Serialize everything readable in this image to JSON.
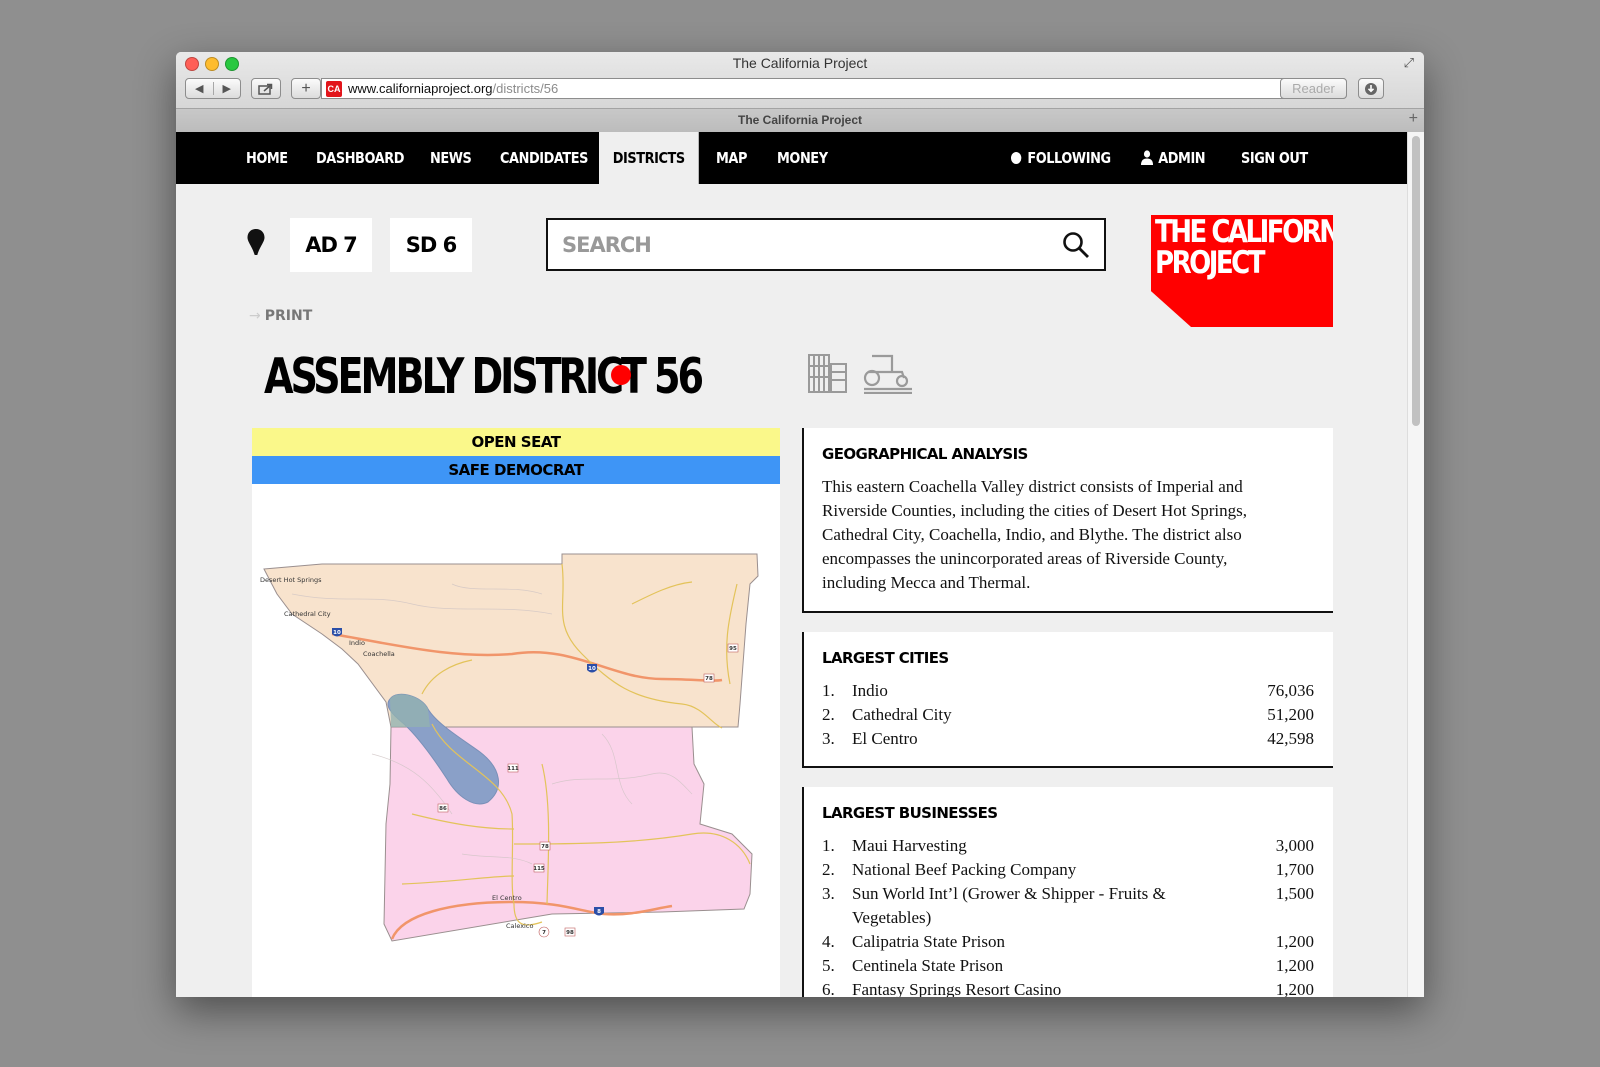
{
  "browser": {
    "window_title": "The California Project",
    "favicon_text": "CA",
    "url_domain": "www.californiaproject.org",
    "url_path": "/districts/56",
    "reader_label": "Reader",
    "tab_title": "The California Project"
  },
  "nav": {
    "items": [
      "HOME",
      "DASHBOARD",
      "NEWS",
      "CANDIDATES",
      "DISTRICTS",
      "MAP",
      "MONEY"
    ],
    "active": "DISTRICTS",
    "following": "FOLLOWING",
    "admin": "ADMIN",
    "sign_out": "SIGN OUT"
  },
  "location": {
    "assembly": "AD 7",
    "senate": "SD 6"
  },
  "search": {
    "placeholder": "SEARCH"
  },
  "logo": {
    "line1": "THE CALIFORNIA",
    "line2": "PROJECT"
  },
  "print_label": "PRINT",
  "district": {
    "title": "ASSEMBLY DISTRICT 56",
    "party_color": "#ff0000",
    "type_icons": [
      "urban-buildings-icon",
      "agriculture-tractor-icon"
    ],
    "seat_status": "OPEN SEAT",
    "lean": "SAFE DEMOCRAT"
  },
  "map": {
    "labels": {
      "desert_hot_springs": "Desert Hot Springs",
      "cathedral_city": "Cathedral City",
      "indio": "Indio",
      "coachella": "Coachella",
      "el_centro": "El Centro",
      "calexico": "Calexico"
    },
    "shields": {
      "i10_west": "10",
      "i10_east": "10",
      "i8": "8",
      "r95": "95",
      "r78": "78",
      "r111": "111",
      "r86": "86",
      "r78b": "78",
      "r115": "115",
      "r7": "7",
      "r98": "98"
    }
  },
  "geographical": {
    "title": "GEOGRAPHICAL ANALYSIS",
    "text": "This eastern Coachella Valley district consists of Imperial and Riverside Counties, including the cities of Desert Hot Springs, Cathedral City, Coachella, Indio, and Blythe. The district also encompasses the unincorporated areas of Riverside County, including Mecca and Thermal."
  },
  "largest_cities": {
    "title": "LARGEST CITIES",
    "rows": [
      {
        "rank": "1.",
        "name": "Indio",
        "value": "76,036"
      },
      {
        "rank": "2.",
        "name": "Cathedral City",
        "value": "51,200"
      },
      {
        "rank": "3.",
        "name": "El Centro",
        "value": "42,598"
      }
    ]
  },
  "largest_businesses": {
    "title": "LARGEST BUSINESSES",
    "rows": [
      {
        "rank": "1.",
        "name": "Maui Harvesting",
        "value": "3,000"
      },
      {
        "rank": "2.",
        "name": "National Beef Packing Company",
        "value": "1,700"
      },
      {
        "rank": "3.",
        "name": "Sun World Int’l (Grower & Shipper - Fruits & Vegetables)",
        "value": "1,500"
      },
      {
        "rank": "4.",
        "name": "Calipatria State Prison",
        "value": "1,200"
      },
      {
        "rank": "5.",
        "name": "Centinela State Prison",
        "value": "1,200"
      },
      {
        "rank": "6.",
        "name": "Fantasy Springs Resort Casino",
        "value": "1,200"
      }
    ]
  }
}
